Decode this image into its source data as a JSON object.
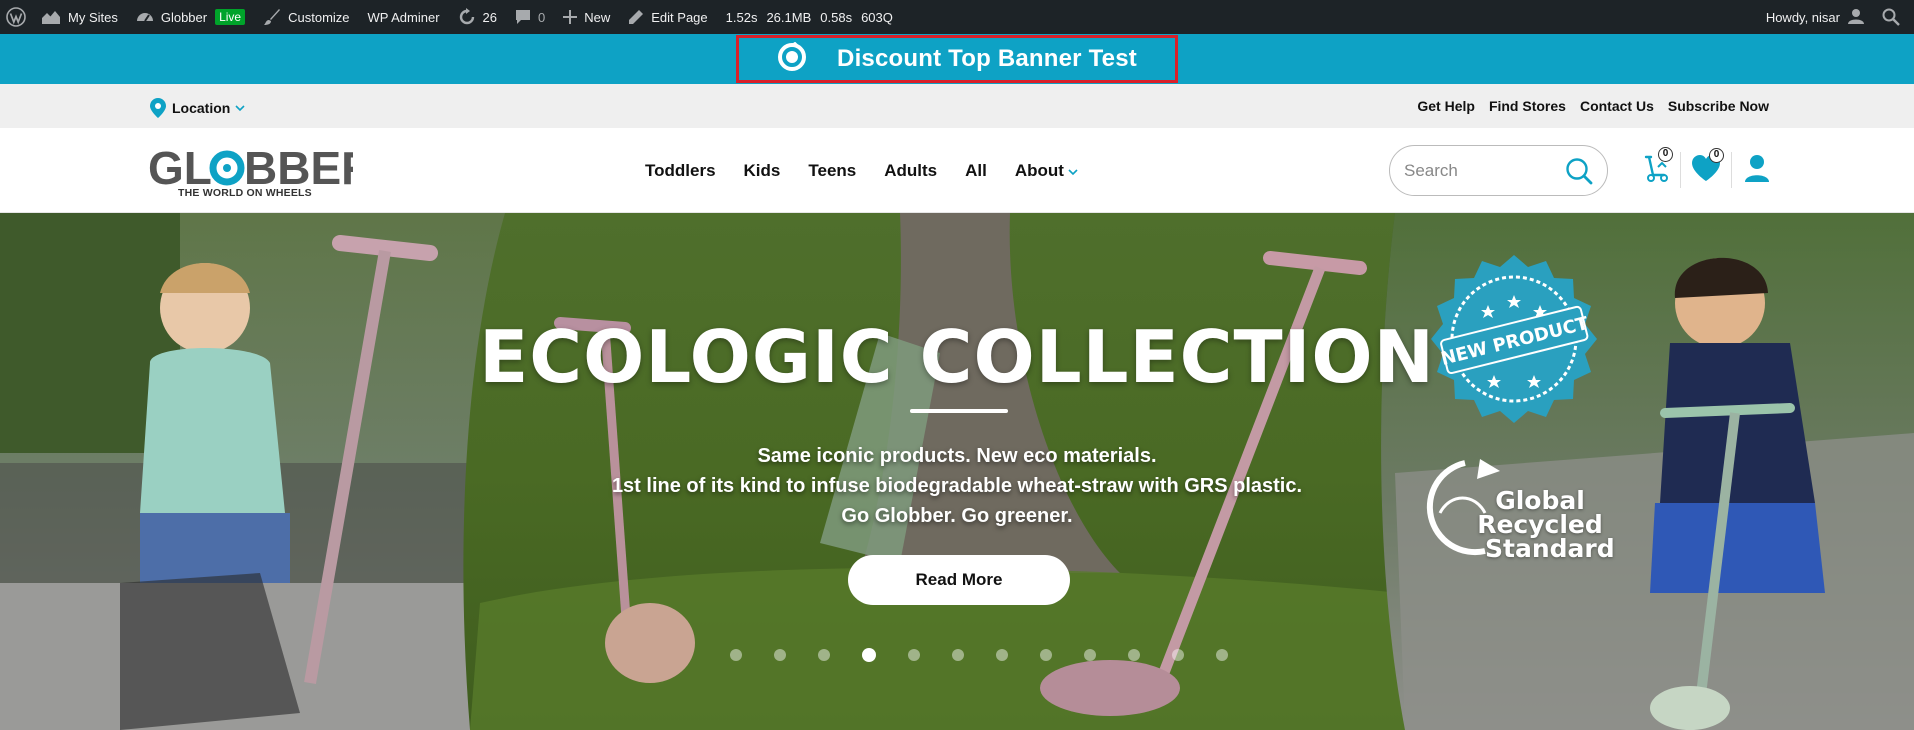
{
  "adminbar": {
    "my_sites": "My Sites",
    "site_name": "Globber",
    "live_badge": "Live",
    "customize": "Customize",
    "wp_adminer": "WP Adminer",
    "updates_count": "26",
    "comments_count": "0",
    "new": "New",
    "edit_page": "Edit Page",
    "stats": {
      "time": "1.52s",
      "memory": "26.1MB",
      "db_time": "0.58s",
      "queries": "603Q"
    },
    "howdy": "Howdy, nisar"
  },
  "promo": {
    "title": "Discount Top Banner Test",
    "border_color": "#d9202a",
    "bg_color": "#0ea2c5"
  },
  "utility": {
    "location": "Location",
    "links": [
      "Get Help",
      "Find Stores",
      "Contact Us",
      "Subscribe Now"
    ]
  },
  "header": {
    "logo": {
      "word": "GLOBBER",
      "tagline": "THE WORLD ON WHEELS"
    },
    "nav": [
      "Toddlers",
      "Kids",
      "Teens",
      "Adults",
      "All",
      "About"
    ],
    "search_placeholder": "Search",
    "compare_count": "0",
    "wishlist_count": "0",
    "icons": [
      "compare-scooter-icon",
      "heart-icon",
      "user-icon"
    ],
    "accent_color": "#0ea2c5"
  },
  "hero": {
    "title": "ECOLOGIC COLLECTION",
    "lines": [
      "Same iconic products. New eco materials.",
      "1st line of its kind to infuse biodegradable wheat-straw with GRS plastic.",
      "Go Globber. Go greener."
    ],
    "button": "Read More",
    "badge_text": "NEW PRODUCT",
    "grs_line1": "Global Recycled",
    "grs_line2": "Standard",
    "slides_total": 12,
    "active_slide": 4
  }
}
